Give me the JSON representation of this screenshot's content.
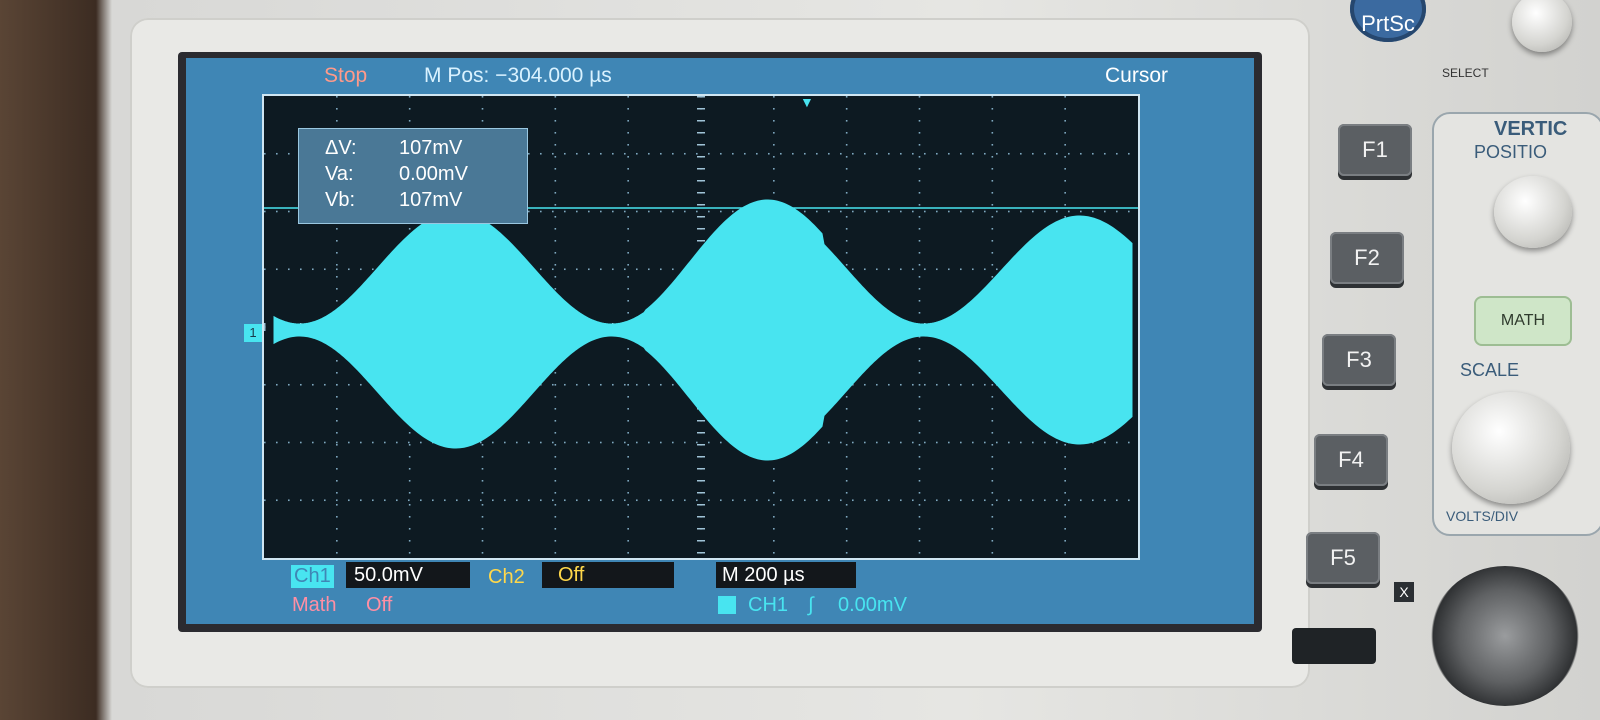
{
  "status": {
    "run_state": "Stop",
    "mpos": "M Pos: −304.000 µs",
    "mode": "Cursor"
  },
  "cursor_readout": {
    "dv_label": "ΔV:",
    "dv_value": "107mV",
    "va_label": "Va:",
    "va_value": "0.00mV",
    "vb_label": "Vb:",
    "vb_value": "107mV"
  },
  "markers": {
    "ch1": "1"
  },
  "bottom": {
    "ch1_label": "Ch1",
    "ch1_volts": "50.0mV",
    "ch2_label": "Ch2",
    "ch2_state": "Off",
    "timebase": "M 200 µs",
    "math_label": "Math",
    "math_state": "Off",
    "trigger_source": "CH1",
    "trigger_edge": "∫",
    "trigger_level": "0.00mV"
  },
  "panel": {
    "prtsc_label": "PrtSc",
    "select_label": "SELECT",
    "f1": "F1",
    "f2": "F2",
    "f3": "F3",
    "f4": "F4",
    "f5": "F5",
    "vertical_label": "VERTIC",
    "position_label": "POSITIO",
    "math_button": "MATH",
    "scale_label": "SCALE",
    "volts_div_label": "VOLTS/DIV",
    "x_label": "X"
  },
  "colors": {
    "trace": "#48e4f0",
    "screen_bg": "#3f86b5",
    "grid_bg": "#0d1a22"
  }
}
